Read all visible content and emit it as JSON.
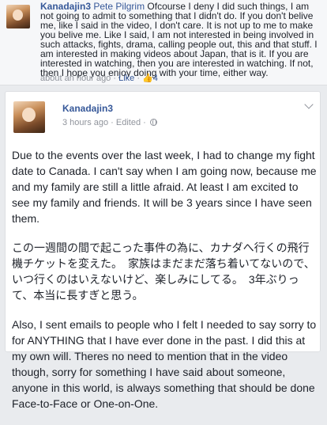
{
  "comment": {
    "author": "Kanadajin3",
    "reply_to": "Pete Pilgrim",
    "text": " Ofcourse I deny I did such things, I am not going to admit to something that I didn't do. If you don't belive me, like I said in the video, I don't care. It is not up to me to make you belive me. Like I said, I am not interested in being involved in such attacks, fights, drama, calling people out, this and that stuff. I am interested in making videos about Japan, that is it. If you are interested in watching, then you are interested in watching. If not, then I hope you enjoy doing with your time, either way.",
    "time": "about an hour ago",
    "sep1": " · ",
    "like_label": "Like",
    "sep2": " · ",
    "like_count": "4"
  },
  "post": {
    "author": "Kanadajin3",
    "time": "3 hours ago",
    "sep": " · ",
    "edited": "Edited",
    "sep2": " · ",
    "paragraphs": [
      "Due to the events over the last week, I had to change my fight date to Canada. I can't say when I am going now, because me and my family are still a little afraid. At least I am excited to see my family and friends. It will be 3 years since I have seen them.",
      "この一週間の間で起こった事件の為に、カナダへ行くの飛行機チケットを変えた。　家族はまだまだ落ち着いてないので、いつ行くのはいえないけど、楽しみにしてる。　3年ぶりって、本当に長すぎと思う。",
      "Also, I sent emails to people who I felt I needed to say sorry to for ANYTHING that I have ever done in the past. I did this at my own will. Theres no need to mention that in the video though, sorry for something I have said about someone, anyone in this world, is always something that should be done Face-to-Face or One-on-One."
    ]
  }
}
